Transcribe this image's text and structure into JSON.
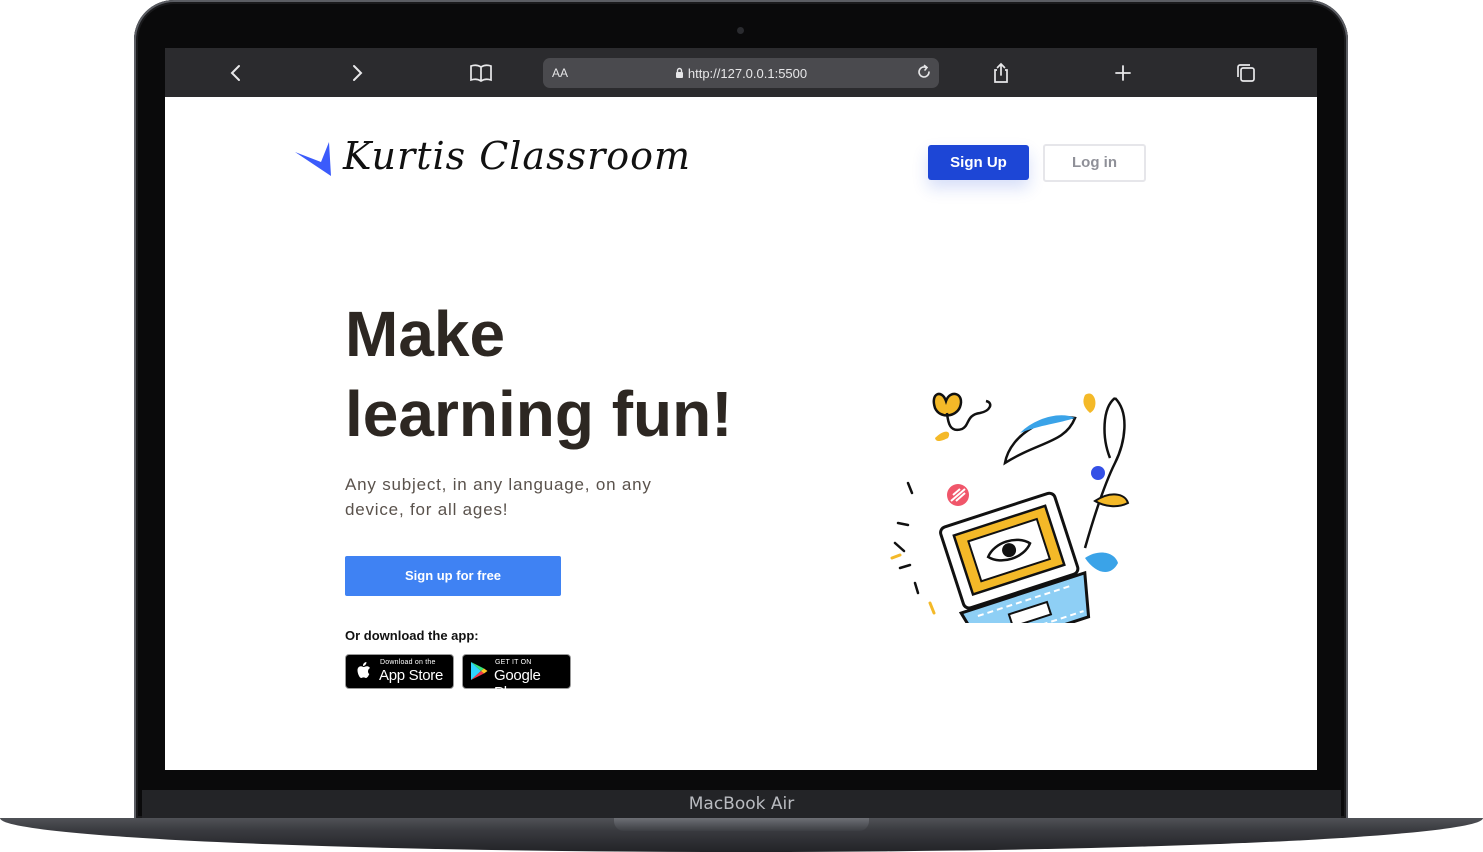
{
  "device": {
    "label": "MacBook Air"
  },
  "browser": {
    "text_size_label": "AA",
    "url": "http://127.0.0.1:5500",
    "icons": [
      "back-icon",
      "forward-icon",
      "bookmarks-icon",
      "lock-icon",
      "reload-icon",
      "share-icon",
      "new-tab-icon",
      "tabs-icon"
    ]
  },
  "header": {
    "logo_text": "Kurtis Classroom",
    "signup_label": "Sign Up",
    "login_label": "Log in"
  },
  "hero": {
    "title_line1": "Make",
    "title_line2": "learning fun!",
    "subtitle": "Any subject, in any language, on any device, for all ages!",
    "cta_label": "Sign up for free",
    "download_label": "Or download the app:",
    "app_store": {
      "small": "Download on the",
      "big": "App Store"
    },
    "google_play": {
      "small": "GET IT ON",
      "big": "Google Play"
    }
  },
  "colors": {
    "primary": "#1d46d6",
    "cta": "#3f82f3",
    "heading": "#2d2722",
    "logo_mark": "#3b5bfb"
  }
}
